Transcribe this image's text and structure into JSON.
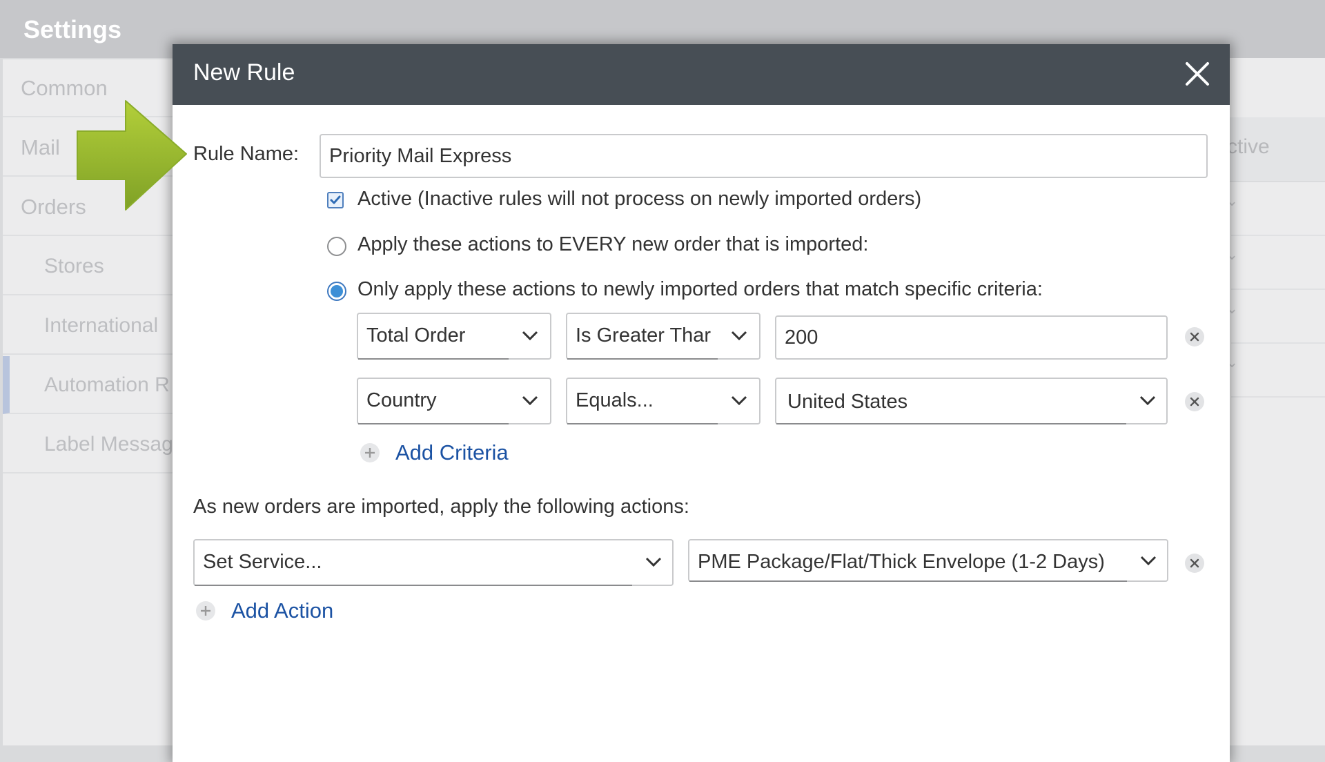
{
  "app": {
    "title": "Settings",
    "sidebar": {
      "items": [
        {
          "label": "Common"
        },
        {
          "label": "Mail"
        },
        {
          "label": "Orders"
        },
        {
          "label": "Stores"
        },
        {
          "label": "International"
        },
        {
          "label": "Automation R"
        },
        {
          "label": "Label Messag"
        }
      ]
    },
    "table_header_partial": "ctive"
  },
  "modal": {
    "title": "New Rule",
    "rule_name_label": "Rule Name:",
    "rule_name_value": "Priority Mail Express",
    "active_checkbox_label": "Active (Inactive rules will not process on newly imported orders)",
    "active_checked": true,
    "option_every_label": "Apply these actions to EVERY new order that is imported:",
    "option_specific_label": "Only apply these actions to newly imported orders that match specific criteria:",
    "criteria": [
      {
        "field": "Total Order",
        "operator": "Is Greater Thar",
        "value": "200"
      },
      {
        "field": "Country",
        "operator": "Equals...",
        "value": "United States"
      }
    ],
    "add_criteria_label": "Add Criteria",
    "actions_heading": "As new orders are imported, apply the following actions:",
    "actions": [
      {
        "action": "Set Service...",
        "value": "PME Package/Flat/Thick Envelope (1-2 Days)"
      }
    ],
    "add_action_label": "Add Action"
  },
  "colors": {
    "header_bg": "#474e55",
    "link": "#1b52a3",
    "arrow": "#9bbb2c"
  }
}
